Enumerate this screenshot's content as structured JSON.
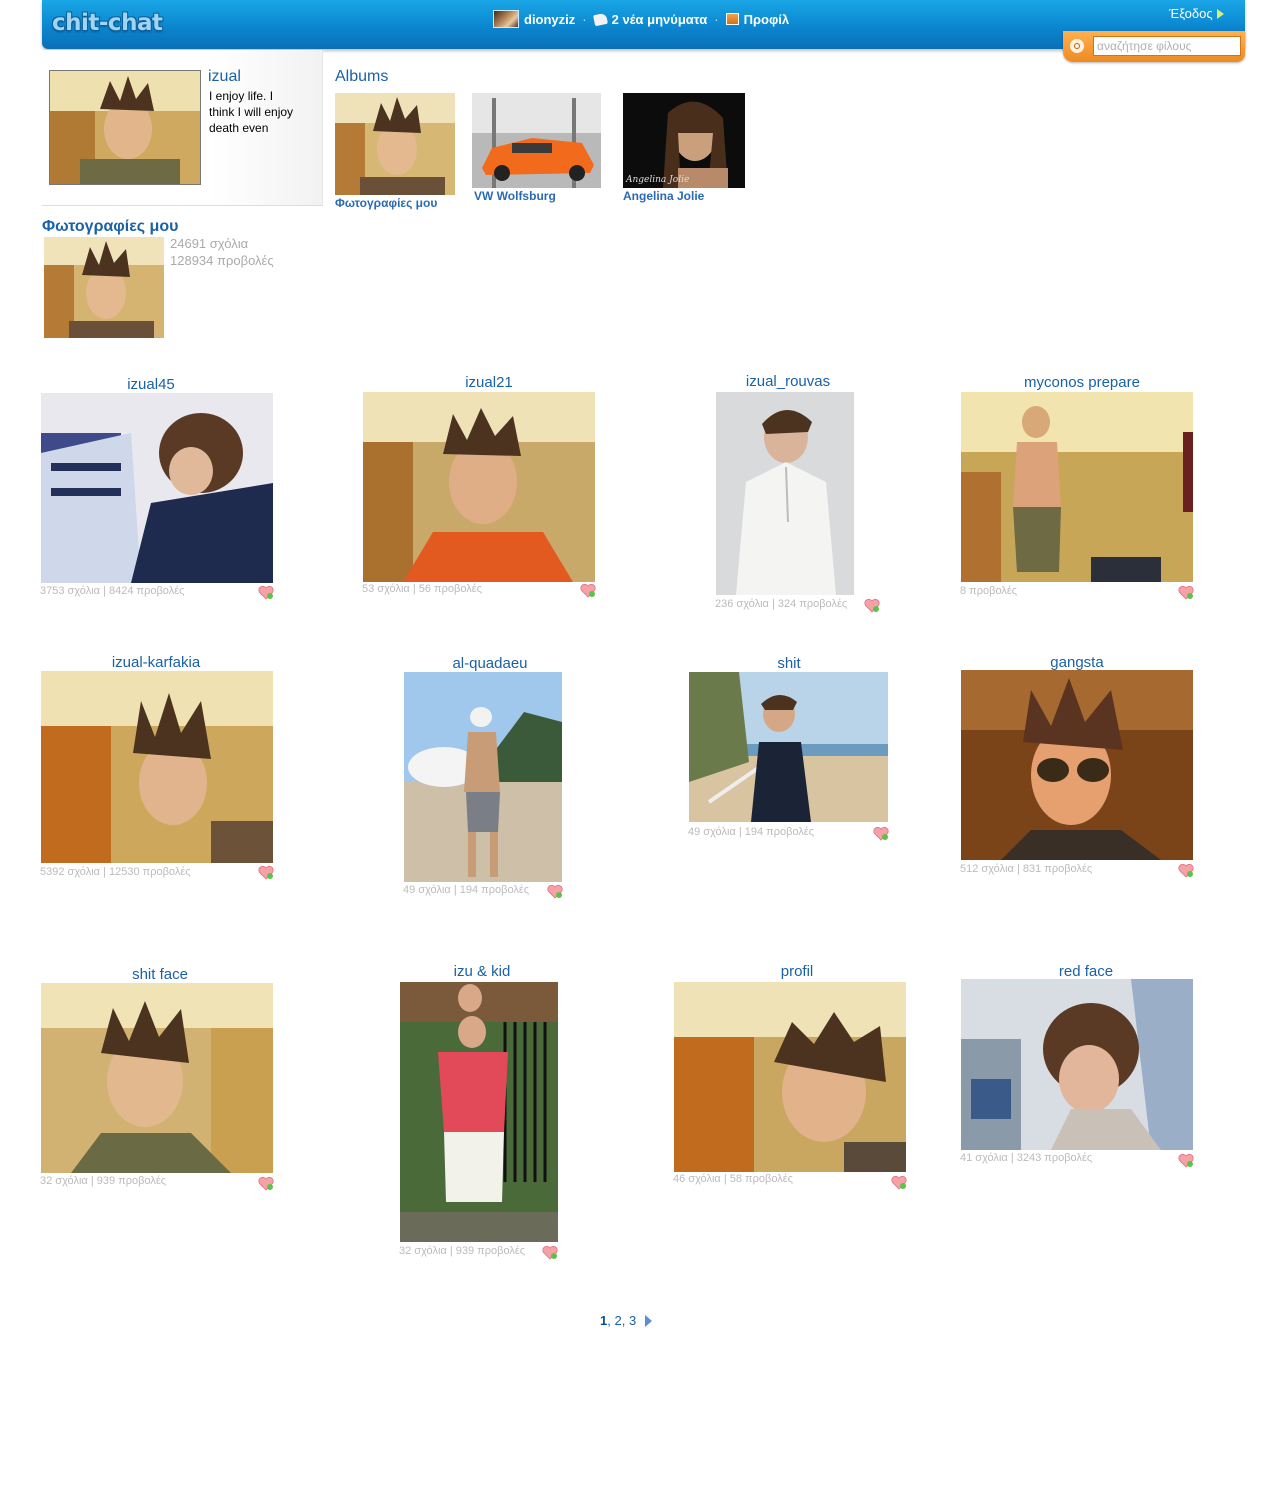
{
  "header": {
    "logo": "chit-chat",
    "username": "dionyziz",
    "messages": "2 νέα μηνύματα",
    "profile": "Προφίλ",
    "logout": "Έξοδος",
    "search_placeholder": "αναζήτησε φίλους"
  },
  "profile": {
    "name": "izual",
    "bio": "I enjoy life. I think I will enjoy death even more."
  },
  "albums": {
    "title": "Albums",
    "items": [
      {
        "label": "Φωτογραφίες μου"
      },
      {
        "label": "VW Wolfsburg"
      },
      {
        "label": "Angelina Jolie"
      }
    ],
    "image_overlay": "Angelina Jolie"
  },
  "my_photos": {
    "title": "Φωτογραφίες μου",
    "comments": "24691 σχόλια",
    "views": "128934 προβολές"
  },
  "photos": [
    {
      "title": "izual45",
      "meta": "3753 σχόλια | 8424 προβολές"
    },
    {
      "title": "izual21",
      "meta": "53 σχόλια | 56 προβολές"
    },
    {
      "title": "izual_rouvas",
      "meta": "236 σχόλια | 324 προβολές"
    },
    {
      "title": "myconos prepare",
      "meta": "8 προβολές"
    },
    {
      "title": "izual-karfakia",
      "meta": "5392 σχόλια | 12530 προβολές"
    },
    {
      "title": "al-quadaeu",
      "meta": "49 σχόλια | 194 προβολές"
    },
    {
      "title": "shit",
      "meta": "49 σχόλια | 194 προβολές"
    },
    {
      "title": "gangsta",
      "meta": "512 σχόλια | 831 προβολές"
    },
    {
      "title": "shit face",
      "meta": "32 σχόλια | 939 προβολές"
    },
    {
      "title": "izu & kid",
      "meta": "32 σχόλια | 939 προβολές"
    },
    {
      "title": "profil",
      "meta": "46 σχόλια | 58 προβολές"
    },
    {
      "title": "red face",
      "meta": "41 σχόλια | 3243 προβολές"
    }
  ],
  "pager": {
    "current": "1",
    "pages": [
      "2",
      "3"
    ]
  },
  "colors": {
    "header_blue": "#0b86cf",
    "link_blue": "#1a61a8",
    "search_orange": "#ee8a22",
    "meta_gray": "#bbbbbb"
  }
}
